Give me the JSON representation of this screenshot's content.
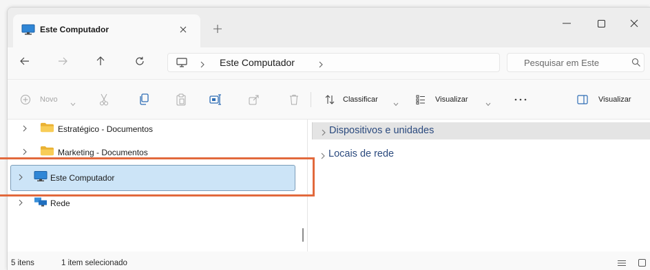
{
  "window": {
    "tab_title": "Este Computador"
  },
  "nav": {
    "location": "Este Computador",
    "search_placeholder": "Pesquisar em Este"
  },
  "commands": {
    "new": "Novo",
    "sort": "Classificar",
    "view": "Visualizar",
    "details": "Visualizar"
  },
  "tree": {
    "items": [
      {
        "label": "Estratégico - Documentos",
        "icon": "folder-icon",
        "selected": false
      },
      {
        "label": "Marketing - Documentos",
        "icon": "folder-icon",
        "selected": false
      },
      {
        "label": "Este Computador",
        "icon": "computer-icon",
        "selected": true
      },
      {
        "label": "Rede",
        "icon": "network-icon",
        "selected": false
      }
    ]
  },
  "content": {
    "groups": [
      {
        "label": "Dispositivos e unidades",
        "collapsed": true,
        "selected": true
      },
      {
        "label": "Locais de rede",
        "collapsed": true,
        "selected": false
      }
    ]
  },
  "status": {
    "item_count": "5 itens",
    "selection": "1 item selecionado"
  },
  "icons": {
    "tab": "computer-icon",
    "tab_close": "close-icon",
    "new_tab": "plus-icon",
    "minimize": "minimize-icon",
    "maximize": "maximize-icon",
    "close": "close-icon",
    "back": "arrow-left-icon",
    "forward": "arrow-right-icon",
    "up": "arrow-up-icon",
    "refresh": "refresh-icon",
    "address": "monitor-icon",
    "search": "search-icon",
    "new": "plus-circle-icon",
    "cut": "scissors-icon",
    "copy": "copy-icon",
    "paste": "paste-icon",
    "rename": "rename-icon",
    "share": "share-icon",
    "delete": "trash-icon",
    "sort": "sort-icon",
    "view": "view-icon",
    "more": "more-icon",
    "details_pane": "details-pane-icon",
    "status_details_view": "details-view-icon",
    "status_tiles_view": "tiles-view-icon"
  },
  "colors": {
    "selection_bg": "#cce4f7",
    "selection_border": "#7a9cb8",
    "accent": "#2e6db5",
    "highlight_annotation": "#e2693c",
    "group_header_bg": "#e4e4e4",
    "group_header_text": "#2b4a7e"
  }
}
